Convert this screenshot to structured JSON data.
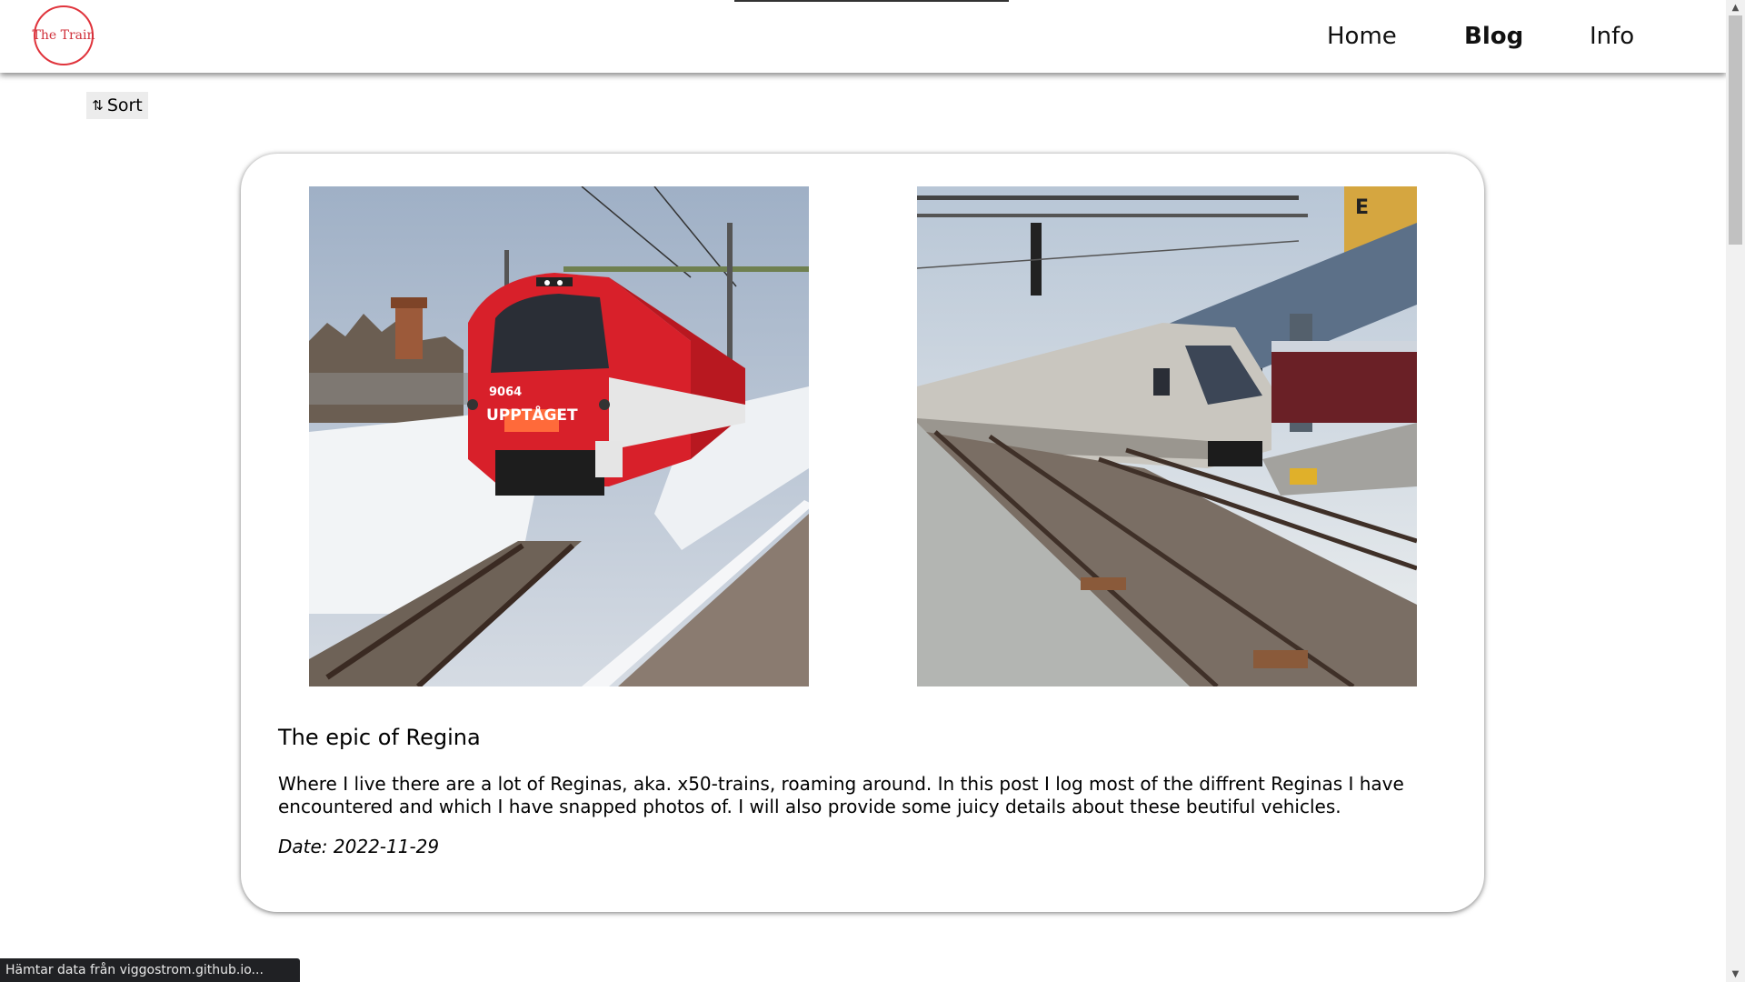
{
  "header": {
    "logo_text": "The Train",
    "nav": {
      "home": "Home",
      "blog": "Blog",
      "info": "Info"
    }
  },
  "toolbar": {
    "sort_icon": "⇅",
    "sort_label": "Sort"
  },
  "post": {
    "title": "The epic of Regina",
    "description": "Where I live there are a lot of Reginas, aka. x50-trains, roaming around. In this post I log most of the diffrent Reginas I have encountered and which I have snapped photos of. I will also provide some juicy details about these beutiful vehicles.",
    "date": "Date: 2022-11-29",
    "images": [
      {
        "number_text": "9064",
        "brand_text": "UPPTÅGET"
      },
      {
        "number_text": "",
        "brand_text": ""
      }
    ]
  },
  "status_bar": {
    "text": "Hämtar data från viggostrom.github.io..."
  },
  "colors": {
    "logo": "#e0343c",
    "train_red": "#d8202a",
    "train_silver": "#c9c6bf"
  }
}
